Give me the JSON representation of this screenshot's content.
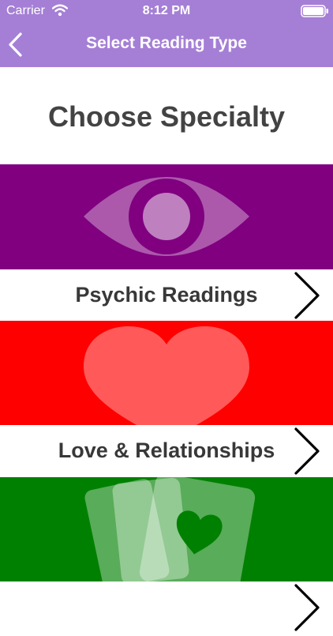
{
  "status_bar": {
    "carrier": "Carrier",
    "time": "8:12 PM",
    "wifi_icon": "wifi-icon",
    "battery_icon": "battery-icon"
  },
  "nav": {
    "title": "Select Reading Type",
    "back_icon": "chevron-left-icon"
  },
  "page": {
    "title": "Choose Specialty"
  },
  "specialties": [
    {
      "label": "Psychic Readings",
      "banner_icon": "eye-icon",
      "banner_color": "#800080",
      "chevron_icon": "chevron-right-icon"
    },
    {
      "label": "Love & Relationships",
      "banner_icon": "heart-icon",
      "banner_color": "#ff0000",
      "chevron_icon": "chevron-right-icon"
    },
    {
      "label": "",
      "banner_icon": "tarot-cards-icon",
      "banner_color": "#008000",
      "chevron_icon": "chevron-right-icon"
    }
  ],
  "colors": {
    "nav_bar": "#a57fd6",
    "title_text": "#434343",
    "label_text": "#383838",
    "icon_overlay": "rgba(255,255,255,0.35)"
  }
}
